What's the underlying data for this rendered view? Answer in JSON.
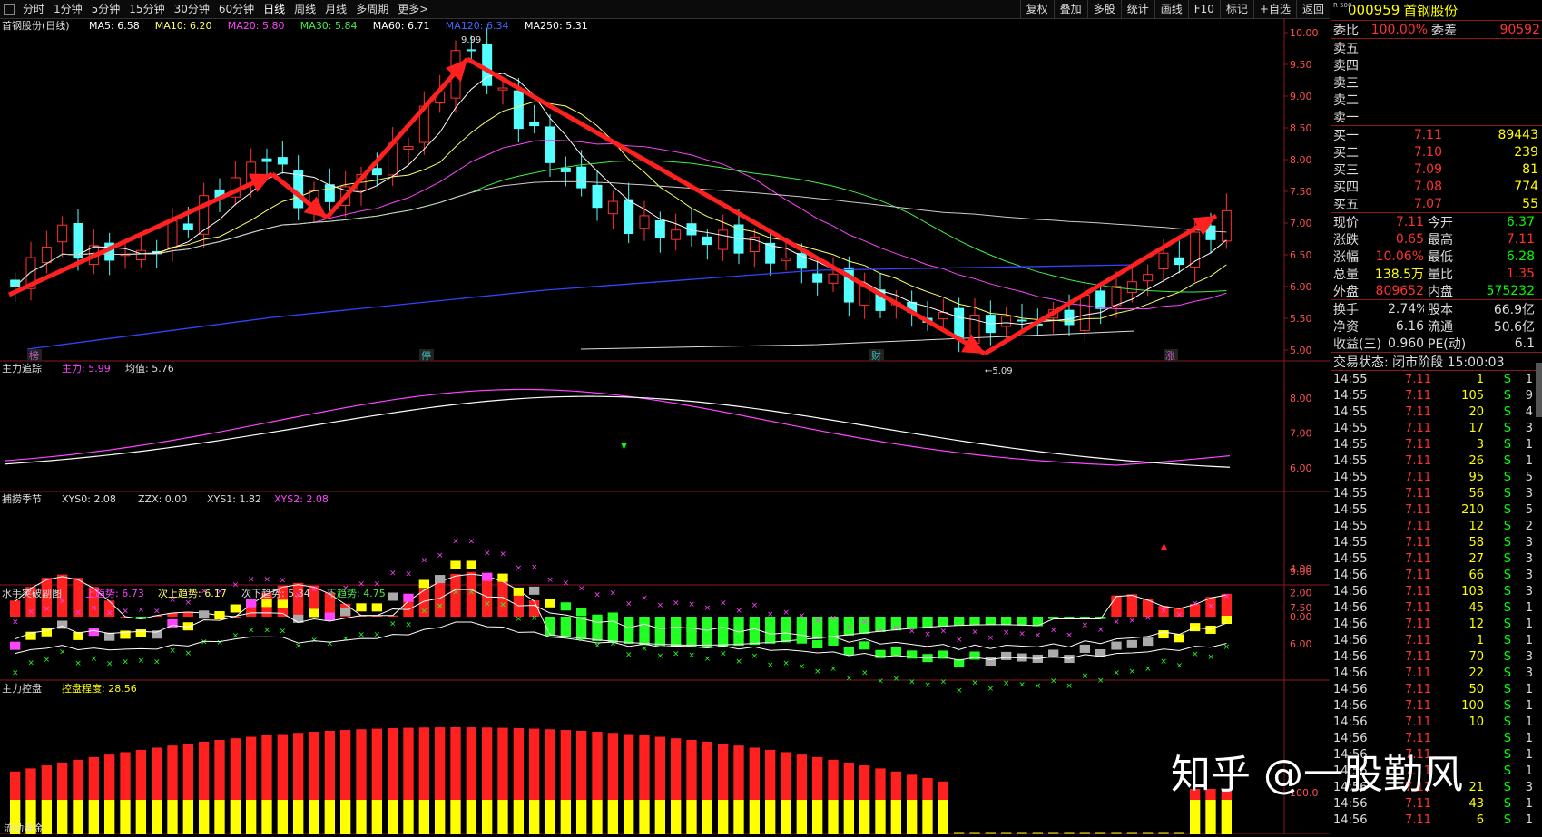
{
  "toolbar": {
    "periods": [
      "分时",
      "1分钟",
      "5分钟",
      "15分钟",
      "30分钟",
      "60分钟",
      "日线",
      "周线",
      "月线",
      "多周期",
      "更多>"
    ],
    "active": "日线",
    "right": [
      "复权",
      "叠加",
      "多股",
      "统计",
      "画线",
      "F10",
      "标记",
      "+自选",
      "返回"
    ]
  },
  "main": {
    "title": "首钢股份(日线)",
    "ma": [
      {
        "label": "MA5: 6.58",
        "color": "#ffffff"
      },
      {
        "label": "MA10: 6.20",
        "color": "#ffff66"
      },
      {
        "label": "MA20: 5.80",
        "color": "#ff44ff"
      },
      {
        "label": "MA30: 5.84",
        "color": "#44ee44"
      },
      {
        "label": "MA60: 6.71",
        "color": "#ffffff"
      },
      {
        "label": "MA120: 6.34",
        "color": "#4466ff"
      },
      {
        "label": "MA250: 5.31",
        "color": "#ffffff"
      }
    ],
    "yticks": [
      "10.00",
      "9.50",
      "9.00",
      "8.50",
      "8.00",
      "7.50",
      "7.00",
      "6.50",
      "6.00",
      "5.50",
      "5.00"
    ],
    "high_label": "9.99",
    "low_label": "←5.09",
    "events": [
      "榜",
      "停",
      "财",
      "涨"
    ]
  },
  "p2": {
    "title": "主力追踪",
    "l1": "主力: 5.99",
    "l2": "均值: 5.76",
    "yticks": [
      "8.00",
      "7.00",
      "6.00"
    ]
  },
  "p3": {
    "title": "捕捞季节",
    "l1": "XYS0: 2.08",
    "l2": "ZZX: 0.00",
    "l3": "XYS1: 1.82",
    "l4": "XYS2: 2.08",
    "yticks": [
      "4.00",
      "2.00",
      "0.00"
    ]
  },
  "p4": {
    "title": "水手突破副图",
    "l1": "上趋势: 6.73",
    "l2": "次上趋势: 6.17",
    "l3": "次下趋势: 5.34",
    "l4": "下趋势: 4.75",
    "yticks": [
      "9.00",
      "7.50",
      "6.00"
    ]
  },
  "p5": {
    "title": "主力控盘",
    "l1": "控盘程度: 28.56",
    "yticks": [
      "100.0"
    ]
  },
  "bottom_title": "流动资金",
  "colors": {
    "up": "#ff3232",
    "down": "#54ffff",
    "bg": "#000000",
    "grid": "#8a1a1a"
  },
  "side": {
    "rlabel": "R 500",
    "code": "000959",
    "name": "首钢股份",
    "weibi": {
      "l": "委比",
      "v": "100.00%",
      "l2": "委差",
      "v2": "90592"
    },
    "asks": [
      "卖五",
      "卖四",
      "卖三",
      "卖二",
      "卖一"
    ],
    "bids": [
      {
        "l": "买一",
        "p": "7.11",
        "v": "89443"
      },
      {
        "l": "买二",
        "p": "7.10",
        "v": "239"
      },
      {
        "l": "买三",
        "p": "7.09",
        "v": "81"
      },
      {
        "l": "买四",
        "p": "7.08",
        "v": "774"
      },
      {
        "l": "买五",
        "p": "7.07",
        "v": "55"
      }
    ],
    "stats": [
      {
        "l": "现价",
        "v": "7.11",
        "vc": "red",
        "l2": "今开",
        "v2": "6.37",
        "v2c": "green"
      },
      {
        "l": "涨跌",
        "v": "0.65",
        "vc": "red",
        "l2": "最高",
        "v2": "7.11",
        "v2c": "red"
      },
      {
        "l": "涨幅",
        "v": "10.06%",
        "vc": "red",
        "l2": "最低",
        "v2": "6.28",
        "v2c": "green"
      },
      {
        "l": "总量",
        "v": "138.5万",
        "vc": "yellow",
        "l2": "量比",
        "v2": "1.35",
        "v2c": "red"
      },
      {
        "l": "外盘",
        "v": "809652",
        "vc": "red",
        "l2": "内盘",
        "v2": "575232",
        "v2c": "green"
      }
    ],
    "stats2": [
      {
        "l": "换手",
        "v": "2.74%",
        "l2": "股本",
        "v2": "66.9亿"
      },
      {
        "l": "净资",
        "v": "6.16",
        "l2": "流通",
        "v2": "50.6亿"
      },
      {
        "l": "收益(三)",
        "v": "0.960",
        "l2": "PE(动)",
        "v2": "6.1"
      }
    ],
    "status": "交易状态: 闭市阶段 15:00:03",
    "ticks": [
      {
        "t": "14:55",
        "p": "7.11",
        "v": "1",
        "s": "S",
        "n": "1"
      },
      {
        "t": "14:55",
        "p": "7.11",
        "v": "105",
        "s": "S",
        "n": "9"
      },
      {
        "t": "14:55",
        "p": "7.11",
        "v": "20",
        "s": "S",
        "n": "4"
      },
      {
        "t": "14:55",
        "p": "7.11",
        "v": "17",
        "s": "S",
        "n": "3"
      },
      {
        "t": "14:55",
        "p": "7.11",
        "v": "3",
        "s": "S",
        "n": "1"
      },
      {
        "t": "14:55",
        "p": "7.11",
        "v": "26",
        "s": "S",
        "n": "1"
      },
      {
        "t": "14:55",
        "p": "7.11",
        "v": "95",
        "s": "S",
        "n": "5"
      },
      {
        "t": "14:55",
        "p": "7.11",
        "v": "56",
        "s": "S",
        "n": "3"
      },
      {
        "t": "14:55",
        "p": "7.11",
        "v": "210",
        "s": "S",
        "n": "5"
      },
      {
        "t": "14:55",
        "p": "7.11",
        "v": "12",
        "s": "S",
        "n": "2"
      },
      {
        "t": "14:55",
        "p": "7.11",
        "v": "58",
        "s": "S",
        "n": "3"
      },
      {
        "t": "14:55",
        "p": "7.11",
        "v": "27",
        "s": "S",
        "n": "3"
      },
      {
        "t": "14:56",
        "p": "7.11",
        "v": "66",
        "s": "S",
        "n": "3"
      },
      {
        "t": "14:56",
        "p": "7.11",
        "v": "103",
        "s": "S",
        "n": "3"
      },
      {
        "t": "14:56",
        "p": "7.11",
        "v": "45",
        "s": "S",
        "n": "1"
      },
      {
        "t": "14:56",
        "p": "7.11",
        "v": "12",
        "s": "S",
        "n": "1"
      },
      {
        "t": "14:56",
        "p": "7.11",
        "v": "1",
        "s": "S",
        "n": "1"
      },
      {
        "t": "14:56",
        "p": "7.11",
        "v": "70",
        "s": "S",
        "n": "3"
      },
      {
        "t": "14:56",
        "p": "7.11",
        "v": "22",
        "s": "S",
        "n": "3"
      },
      {
        "t": "14:56",
        "p": "7.11",
        "v": "50",
        "s": "S",
        "n": "1"
      },
      {
        "t": "14:56",
        "p": "7.11",
        "v": "100",
        "s": "S",
        "n": "1"
      },
      {
        "t": "14:56",
        "p": "7.11",
        "v": "10",
        "s": "S",
        "n": "1"
      },
      {
        "t": "14:56",
        "p": "7.11",
        "v": "",
        "s": "S",
        "n": "1"
      },
      {
        "t": "14:56",
        "p": "7.11",
        "v": "",
        "s": "S",
        "n": "1"
      },
      {
        "t": "14:56",
        "p": "7.11",
        "v": "",
        "s": "S",
        "n": "1"
      },
      {
        "t": "14:56",
        "p": "7.11",
        "v": "21",
        "s": "S",
        "n": "3"
      },
      {
        "t": "14:56",
        "p": "7.11",
        "v": "43",
        "s": "S",
        "n": "1"
      },
      {
        "t": "14:56",
        "p": "7.11",
        "v": "6",
        "s": "S",
        "n": "1"
      }
    ]
  },
  "watermark": "知乎 @一股勤风"
}
